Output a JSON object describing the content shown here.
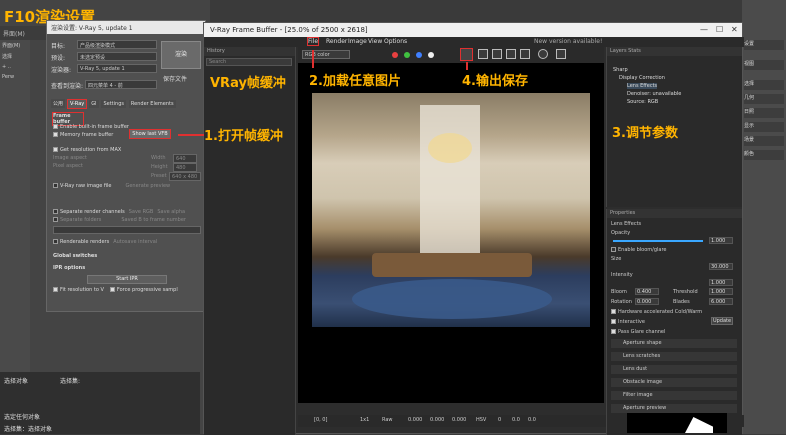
{
  "annotation_title": "F10渲染设置",
  "annotations": {
    "vray_vfb": "VRay帧缓冲",
    "step1": "1.打开帧缓冲",
    "step2": "2.加载任意图片",
    "step3": "3.调节参数",
    "step4": "4.输出保存"
  },
  "colors": {
    "annotation": "#ffb400",
    "highlight": "#e03030",
    "accent": "#3aa7ff"
  },
  "background": {
    "left_menu": "界面(M)",
    "left_side": [
      "界面(M)",
      "选择",
      "+  ..",
      "Perw"
    ],
    "status_line1": "选择对象",
    "status_line2": "选择集:",
    "status_bar1": "选定任何对象",
    "status_bar2": "选择集：选择对象",
    "right_items": [
      "设置",
      "视图",
      "选择",
      "几何",
      "日照",
      "显示",
      "场景",
      "颜色"
    ]
  },
  "render_setup": {
    "title": "渲染设置: V-Ray 5, update 1",
    "target_label": "目标:",
    "target_value": "产品级渲染模式",
    "preset_label": "预设:",
    "preset_value": "未选定预设",
    "renderer_label": "渲染器:",
    "renderer_value": "V-Ray 5, update 1",
    "view_label": "查看到渲染:",
    "view_value": "四元菜单 4 - 前",
    "render_button": "渲染",
    "save_file": "保存文件",
    "tabs": [
      "公用",
      "V-Ray",
      "GI",
      "Settings",
      "Render Elements"
    ],
    "frame_buffer_section": "Frame buffer",
    "enable_vfb": "Enable built-in frame buffer",
    "memory_fb": "Memory frame buffer",
    "show_last_vfb": "Show last VFB",
    "get_resolution": "Get resolution from MAX",
    "width_label": "Width",
    "width_value": "640",
    "height_label": "Height",
    "height_value": "480",
    "image_aspect": "Image aspect",
    "pixel_aspect": "Pixel aspect",
    "preset_label2": "Preset",
    "preset_value2": "640 x 480",
    "vray_raw": "V-Ray raw image file",
    "generate_preview": "Generate preview",
    "separate_channels": "Separate render channels",
    "save_rgb": "Save RGB",
    "save_alpha": "Save alpha",
    "separate_folders": "Separate folders",
    "vfb_to_frame": "Saved B to frame number",
    "renderable_vfb": "Renderable renders",
    "autosave_interval": "Autosave interval",
    "global_switches": "Global switches",
    "ipr_options": "IPR options",
    "start_ipr": "Start IPR",
    "fit_resolution": "Fit resolution to V",
    "force_progressive": "Force progressive sampl"
  },
  "vfb": {
    "title": "V-Ray Frame Buffer - [25.0% of 2500 x 2618]",
    "menu": [
      "File",
      "Render",
      "Image",
      "View",
      "Options"
    ],
    "new_version": "New version available!",
    "history_header": "History",
    "history_search": "Search",
    "channel_select": "RGB color",
    "layers_header": "Layers",
    "stats_header": "Stats",
    "layers": [
      "Sharp",
      "Display Correction",
      "Lens Effects",
      "Denoiser: unavailable",
      "Source: RGB"
    ],
    "properties_header": "Properties",
    "lens_effects_label": "Lens Effects",
    "props": {
      "opacity": "Opacity",
      "opacity_value": "1.000",
      "enable_bloom": "Enable bloom/glare",
      "size": "Size",
      "size_value": "30.000",
      "intensity": "Intensity",
      "intensity_value": "1.000",
      "bloom": "Bloom",
      "bloom_value": "0.400",
      "threshold": "Threshold",
      "threshold_value": "1.000",
      "rotation": "Rotation",
      "rotation_value": "0.000",
      "blades": "Blades",
      "blades_value": "6.000",
      "hw_accel": "Hardware accelerated",
      "cold_warm": "Cold/Warm",
      "interactive": "Interactive",
      "update": "Update",
      "pass_glare": "Pass Glare channel",
      "sections": [
        "Aperture shape",
        "Lens scratches",
        "Lens dust",
        "Obstacle image",
        "Filter image",
        "Aperture preview"
      ]
    },
    "bottom": {
      "coord": "[0, 0]",
      "mode": "1x1",
      "raw": "Raw",
      "v1": "0.000",
      "v2": "0.000",
      "v3": "0.000",
      "hsv": "HSV",
      "v4": "0",
      "v5": "0.0",
      "v6": "0.0"
    }
  },
  "chart_data": null
}
